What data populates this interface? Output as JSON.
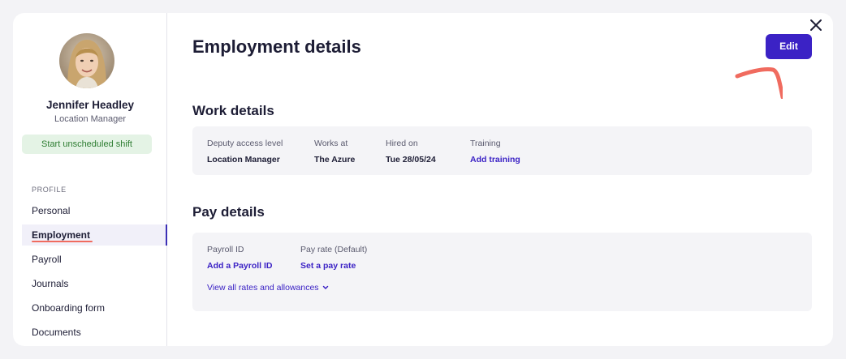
{
  "profile": {
    "name": "Jennifer Headley",
    "role": "Location Manager",
    "start_shift_label": "Start unscheduled shift"
  },
  "sidebar": {
    "section_label": "PROFILE",
    "items": [
      {
        "label": "Personal",
        "active": false
      },
      {
        "label": "Employment",
        "active": true
      },
      {
        "label": "Payroll",
        "active": false
      },
      {
        "label": "Journals",
        "active": false
      },
      {
        "label": "Onboarding form",
        "active": false
      },
      {
        "label": "Documents",
        "active": false
      }
    ]
  },
  "main": {
    "title": "Employment details",
    "edit_label": "Edit",
    "work": {
      "heading": "Work details",
      "fields": [
        {
          "label": "Deputy access level",
          "value": "Location Manager"
        },
        {
          "label": "Works at",
          "value": "The Azure"
        },
        {
          "label": "Hired on",
          "value": "Tue 28/05/24"
        },
        {
          "label": "Training",
          "value": "Add training"
        }
      ]
    },
    "pay": {
      "heading": "Pay details",
      "fields": [
        {
          "label": "Payroll ID",
          "value": "Add a Payroll ID"
        },
        {
          "label": "Pay rate (Default)",
          "value": "Set a pay rate"
        }
      ],
      "view_all_label": "View all rates and allowances"
    }
  },
  "colors": {
    "accent": "#3b22c5",
    "annotation": "#f06b5f",
    "shift_bg": "#e4f3e5",
    "shift_text": "#2e7d32"
  },
  "icons": [
    "close-icon",
    "chevron-down-icon"
  ]
}
